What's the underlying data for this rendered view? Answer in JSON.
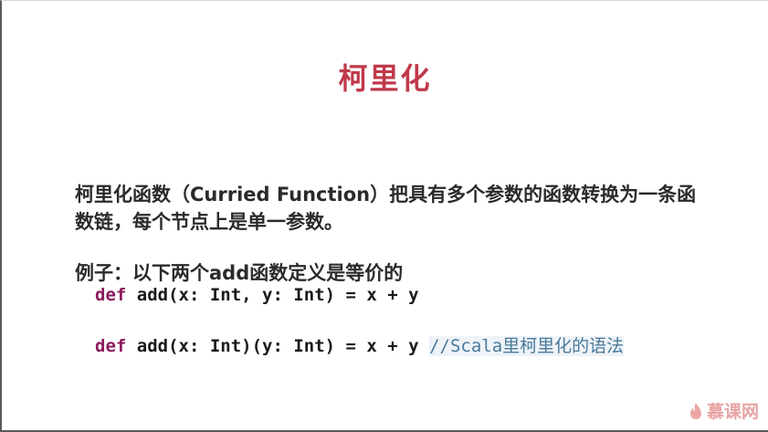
{
  "slide": {
    "title": "柯里化",
    "paragraph1": "柯里化函数（Curried Function）把具有多个参数的函数转换为一条函数链，每个节点上是单一参数。",
    "paragraph2": "例子：以下两个add函数定义是等价的",
    "code1": {
      "keyword": "def",
      "text": " add(x: Int, y: Int) = x + y"
    },
    "code2": {
      "keyword": "def",
      "text": " add(x: Int)(y: Int) = x + y ",
      "comment": "//Scala里柯里化的语法"
    }
  },
  "watermark": {
    "icon": "flame-logo-icon",
    "text": "慕课网"
  },
  "colors": {
    "title": "#c0394b",
    "keyword": "#8b1a5c",
    "comment": "#4a7a9a",
    "watermark": "#e6a3a3"
  }
}
